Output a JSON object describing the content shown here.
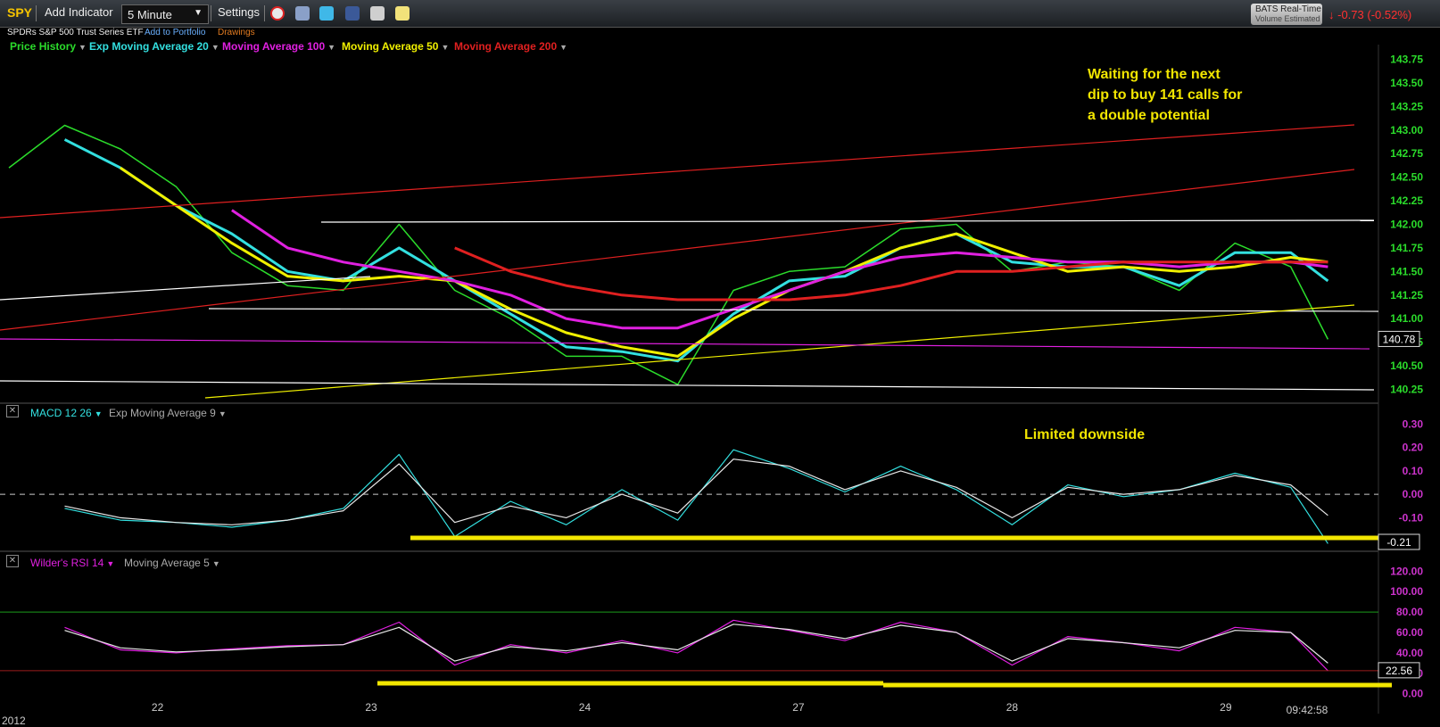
{
  "toolbar": {
    "symbol": "SPY",
    "add_indicator": "Add Indicator",
    "interval": "5 Minute",
    "settings": "Settings",
    "icons": [
      "alarm-clock-icon",
      "notes-icon",
      "twitter-icon",
      "facebook-icon",
      "binoculars-icon",
      "sticky-note-icon"
    ],
    "data_source": "BATS Real-Time",
    "volume_note": "Volume Estimated",
    "change": "-0.73 (-0.52%)",
    "change_color": "#ff3030"
  },
  "subheader": {
    "security_name": "SPDRs S&P 500 Trust Series ETF",
    "add_to_portfolio": "Add to Portfolio",
    "drawings": "Drawings"
  },
  "price_panel": {
    "legend": [
      {
        "label": "Price History",
        "color": "#2bdc2b"
      },
      {
        "label": "Exp Moving Average 20",
        "color": "#33e0e0"
      },
      {
        "label": "Moving Average 100",
        "color": "#e020e0"
      },
      {
        "label": "Moving Average 50",
        "color": "#f0f000"
      },
      {
        "label": "Moving Average 200",
        "color": "#e02020"
      }
    ],
    "annotation": [
      "Waiting for the next",
      "dip to buy 141 calls for",
      "a double potential"
    ],
    "last_price": "140.78"
  },
  "macd_panel": {
    "legend": [
      "MACD 12 26",
      "Exp Moving Average 9"
    ],
    "annotation": "Limited downside",
    "last_value": "-0.21"
  },
  "rsi_panel": {
    "legend": [
      "Wilder's RSI 14",
      "Moving Average 5"
    ],
    "last_value": "22.56"
  },
  "footer": {
    "year": "2012",
    "time": "09:42:58"
  },
  "chart_data": [
    {
      "type": "line",
      "title": "SPY 5 Minute",
      "x_ticks": [
        "22",
        "23",
        "24",
        "27",
        "28",
        "29"
      ],
      "y_ticks": [
        "140.25",
        "140.50",
        "140.75",
        "141.00",
        "141.25",
        "141.50",
        "141.75",
        "142.00",
        "142.25",
        "142.50",
        "142.75",
        "143.00",
        "143.25",
        "143.50",
        "143.75"
      ],
      "ylim": [
        140.15,
        143.85
      ],
      "x": [
        0,
        0.3,
        0.6,
        0.9,
        1.2,
        1.5,
        1.8,
        2.1,
        2.4,
        2.7,
        3.0,
        3.3,
        3.6,
        3.9,
        4.2,
        4.5,
        4.8,
        5.1,
        5.4,
        5.7,
        6.0,
        6.3,
        6.6,
        6.9,
        7.1
      ],
      "series": [
        {
          "name": "Price History",
          "color": "#2bdc2b",
          "values": [
            142.6,
            143.05,
            142.8,
            142.4,
            141.7,
            141.35,
            141.3,
            142.0,
            141.3,
            141.0,
            140.6,
            140.6,
            140.3,
            141.3,
            141.5,
            141.55,
            141.95,
            142.0,
            141.5,
            141.6,
            141.55,
            141.3,
            141.8,
            141.55,
            140.78
          ]
        },
        {
          "name": "Exp Moving Average 20",
          "color": "#33e0e0",
          "values": [
            null,
            142.9,
            142.6,
            142.2,
            141.9,
            141.5,
            141.4,
            141.75,
            141.4,
            141.05,
            140.7,
            140.65,
            140.55,
            141.05,
            141.4,
            141.45,
            141.75,
            141.9,
            141.6,
            141.55,
            141.55,
            141.35,
            141.7,
            141.7,
            141.4
          ]
        },
        {
          "name": "Moving Average 50",
          "color": "#f0f000",
          "values": [
            null,
            null,
            142.6,
            142.2,
            141.8,
            141.45,
            141.4,
            141.45,
            141.4,
            141.1,
            140.85,
            140.7,
            140.6,
            141.0,
            141.3,
            141.5,
            141.75,
            141.9,
            141.7,
            141.5,
            141.55,
            141.5,
            141.55,
            141.65,
            141.6
          ]
        },
        {
          "name": "Moving Average 100",
          "color": "#e020e0",
          "values": [
            null,
            null,
            null,
            null,
            142.15,
            141.75,
            141.6,
            141.5,
            141.4,
            141.25,
            141.0,
            140.9,
            140.9,
            141.1,
            141.3,
            141.5,
            141.65,
            141.7,
            141.65,
            141.6,
            141.6,
            141.55,
            141.6,
            141.6,
            141.55
          ]
        },
        {
          "name": "Moving Average 200",
          "color": "#e02020",
          "values": [
            null,
            null,
            null,
            null,
            null,
            null,
            null,
            null,
            141.75,
            141.5,
            141.35,
            141.25,
            141.2,
            141.2,
            141.2,
            141.25,
            141.35,
            141.5,
            141.5,
            141.55,
            141.6,
            141.6,
            141.6,
            141.6,
            141.6
          ]
        }
      ]
    },
    {
      "type": "line",
      "title": "MACD 12 26",
      "y_ticks": [
        "-0.10",
        "0.00",
        "0.10",
        "0.20",
        "0.30"
      ],
      "ylim": [
        -0.22,
        0.32
      ],
      "x": [
        0,
        0.3,
        0.6,
        0.9,
        1.2,
        1.5,
        1.8,
        2.1,
        2.4,
        2.7,
        3.0,
        3.3,
        3.6,
        3.9,
        4.2,
        4.5,
        4.8,
        5.1,
        5.4,
        5.7,
        6.0,
        6.3,
        6.6,
        6.9,
        7.1
      ],
      "series": [
        {
          "name": "MACD 12 26",
          "color": "#33e0e0",
          "values": [
            null,
            -0.06,
            -0.11,
            -0.12,
            -0.14,
            -0.11,
            -0.06,
            0.17,
            -0.18,
            -0.03,
            -0.13,
            0.02,
            -0.11,
            0.19,
            0.11,
            0.01,
            0.12,
            0.02,
            -0.13,
            0.04,
            -0.01,
            0.02,
            0.09,
            0.03,
            -0.21
          ]
        },
        {
          "name": "Exp Moving Average 9",
          "color": "#e8e8e8",
          "values": [
            null,
            -0.05,
            -0.1,
            -0.12,
            -0.13,
            -0.11,
            -0.07,
            0.13,
            -0.12,
            -0.05,
            -0.1,
            0.0,
            -0.08,
            0.15,
            0.12,
            0.02,
            0.1,
            0.03,
            -0.1,
            0.03,
            0.0,
            0.02,
            0.08,
            0.04,
            -0.09
          ]
        }
      ]
    },
    {
      "type": "line",
      "title": "Wilder's RSI 14",
      "y_ticks": [
        "0.00",
        "20.00",
        "40.00",
        "60.00",
        "80.00",
        "100.00",
        "120.00"
      ],
      "ylim": [
        -2,
        122
      ],
      "x": [
        0,
        0.3,
        0.6,
        0.9,
        1.2,
        1.5,
        1.8,
        2.1,
        2.4,
        2.7,
        3.0,
        3.3,
        3.6,
        3.9,
        4.2,
        4.5,
        4.8,
        5.1,
        5.4,
        5.7,
        6.0,
        6.3,
        6.6,
        6.9,
        7.1
      ],
      "series": [
        {
          "name": "Wilder's RSI 14",
          "color": "#e020e0",
          "values": [
            null,
            65,
            43,
            40,
            44,
            47,
            48,
            70,
            28,
            48,
            40,
            52,
            40,
            72,
            62,
            52,
            70,
            60,
            28,
            56,
            50,
            42,
            65,
            60,
            22.56
          ]
        },
        {
          "name": "Moving Average 5",
          "color": "#e8e8e8",
          "values": [
            null,
            62,
            45,
            41,
            43,
            46,
            48,
            65,
            32,
            46,
            42,
            50,
            43,
            68,
            63,
            54,
            67,
            60,
            32,
            54,
            50,
            45,
            62,
            60,
            30
          ]
        }
      ]
    }
  ]
}
